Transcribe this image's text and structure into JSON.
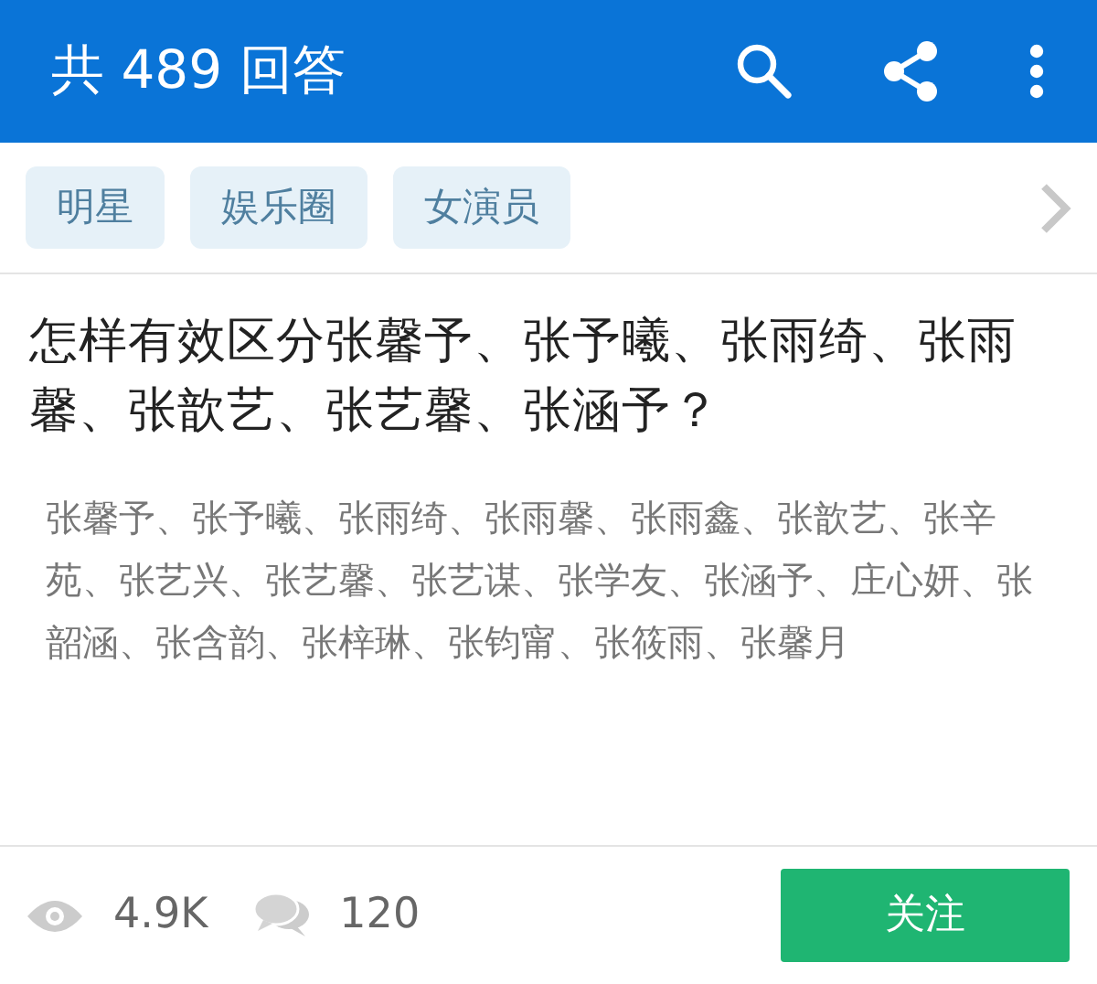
{
  "header": {
    "title": "共 489 回答"
  },
  "tags": [
    {
      "label": "明星"
    },
    {
      "label": "娱乐圈"
    },
    {
      "label": "女演员"
    }
  ],
  "question": {
    "title": "怎样有效区分张馨予、张予曦、张雨绮、张雨馨、张歆艺、张艺馨、张涵予？",
    "description": "张馨予、张予曦、张雨绮、张雨馨、张雨鑫、张歆艺、张辛苑、张艺兴、张艺馨、张艺谋、张学友、张涵予、庄心妍、张韶涵、张含韵、张梓琳、张钧甯、张筱雨、张馨月"
  },
  "footer": {
    "views": "4.9K",
    "comments": "120",
    "follow_button": "关注"
  }
}
